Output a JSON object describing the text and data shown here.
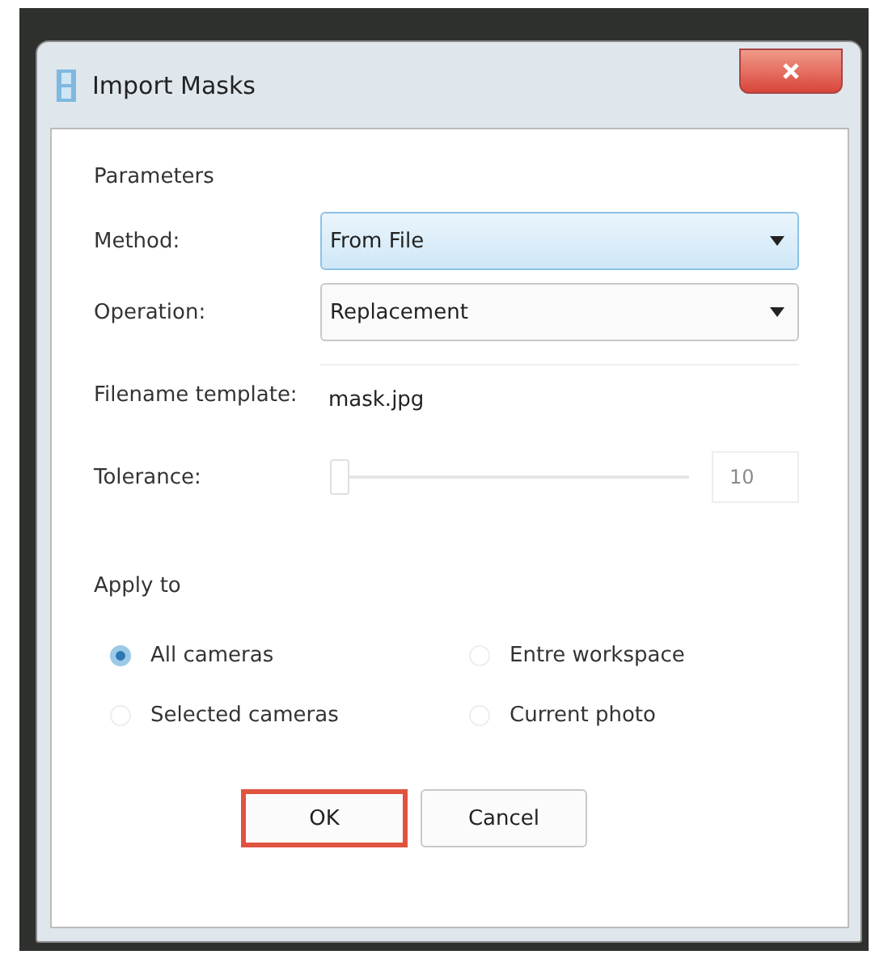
{
  "window": {
    "title": "Import Masks"
  },
  "parameters": {
    "heading": "Parameters",
    "method": {
      "label": "Method:",
      "value": "From File",
      "focused": true
    },
    "operation": {
      "label": "Operation:",
      "value": "Replacement",
      "focused": false
    },
    "filename_template": {
      "label": "Filename template:",
      "value": "mask.jpg"
    },
    "tolerance": {
      "label": "Tolerance:",
      "level": 0,
      "value": "10",
      "disabled": true
    }
  },
  "apply_to": {
    "heading": "Apply to",
    "options": [
      {
        "label": "All cameras",
        "selected": true
      },
      {
        "label": "Entre workspace",
        "selected": false
      },
      {
        "label": "Selected cameras",
        "selected": false
      },
      {
        "label": "Current photo",
        "selected": false
      }
    ]
  },
  "buttons": [
    {
      "label": "OK",
      "highlighted": true
    },
    {
      "label": "Cancel",
      "highlighted": false
    }
  ]
}
